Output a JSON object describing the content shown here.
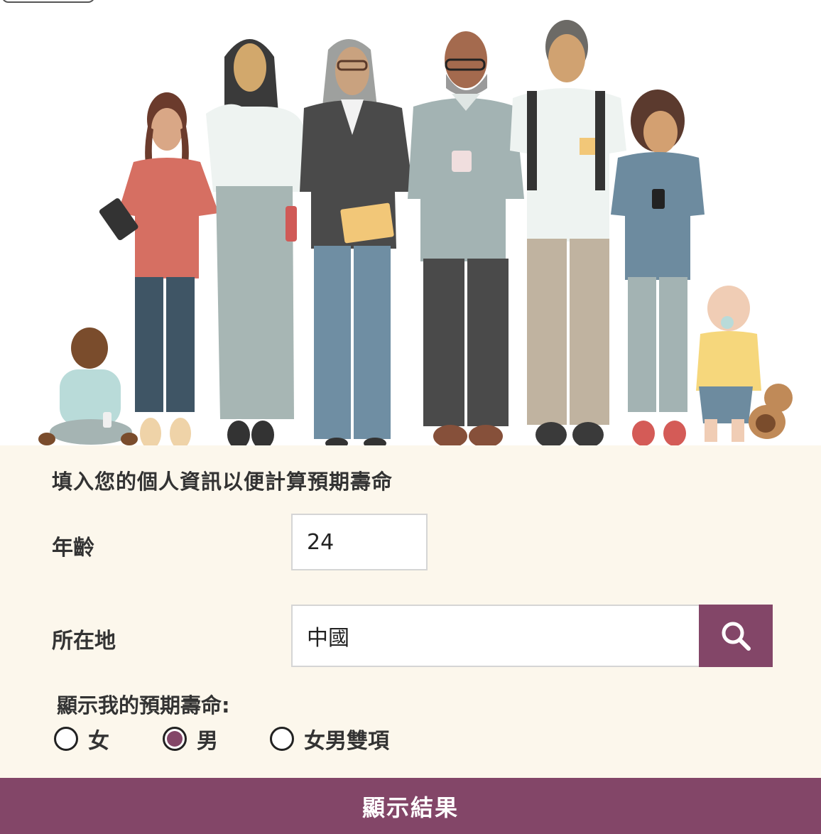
{
  "form": {
    "heading": "填入您的個人資訊以便計算預期壽命",
    "age_label": "年齡",
    "age_value": "24",
    "location_label": "所在地",
    "location_value": "中國",
    "search_icon": "search-icon",
    "sex_prompt": "顯示我的預期壽命:",
    "sex_options": [
      {
        "label": "女",
        "selected": false
      },
      {
        "label": "男",
        "selected": true
      },
      {
        "label": "女男雙項",
        "selected": false
      }
    ],
    "submit_label": "顯示結果"
  },
  "colors": {
    "accent": "#834668",
    "panel_bg": "#fcf7ec",
    "text": "#333333"
  }
}
